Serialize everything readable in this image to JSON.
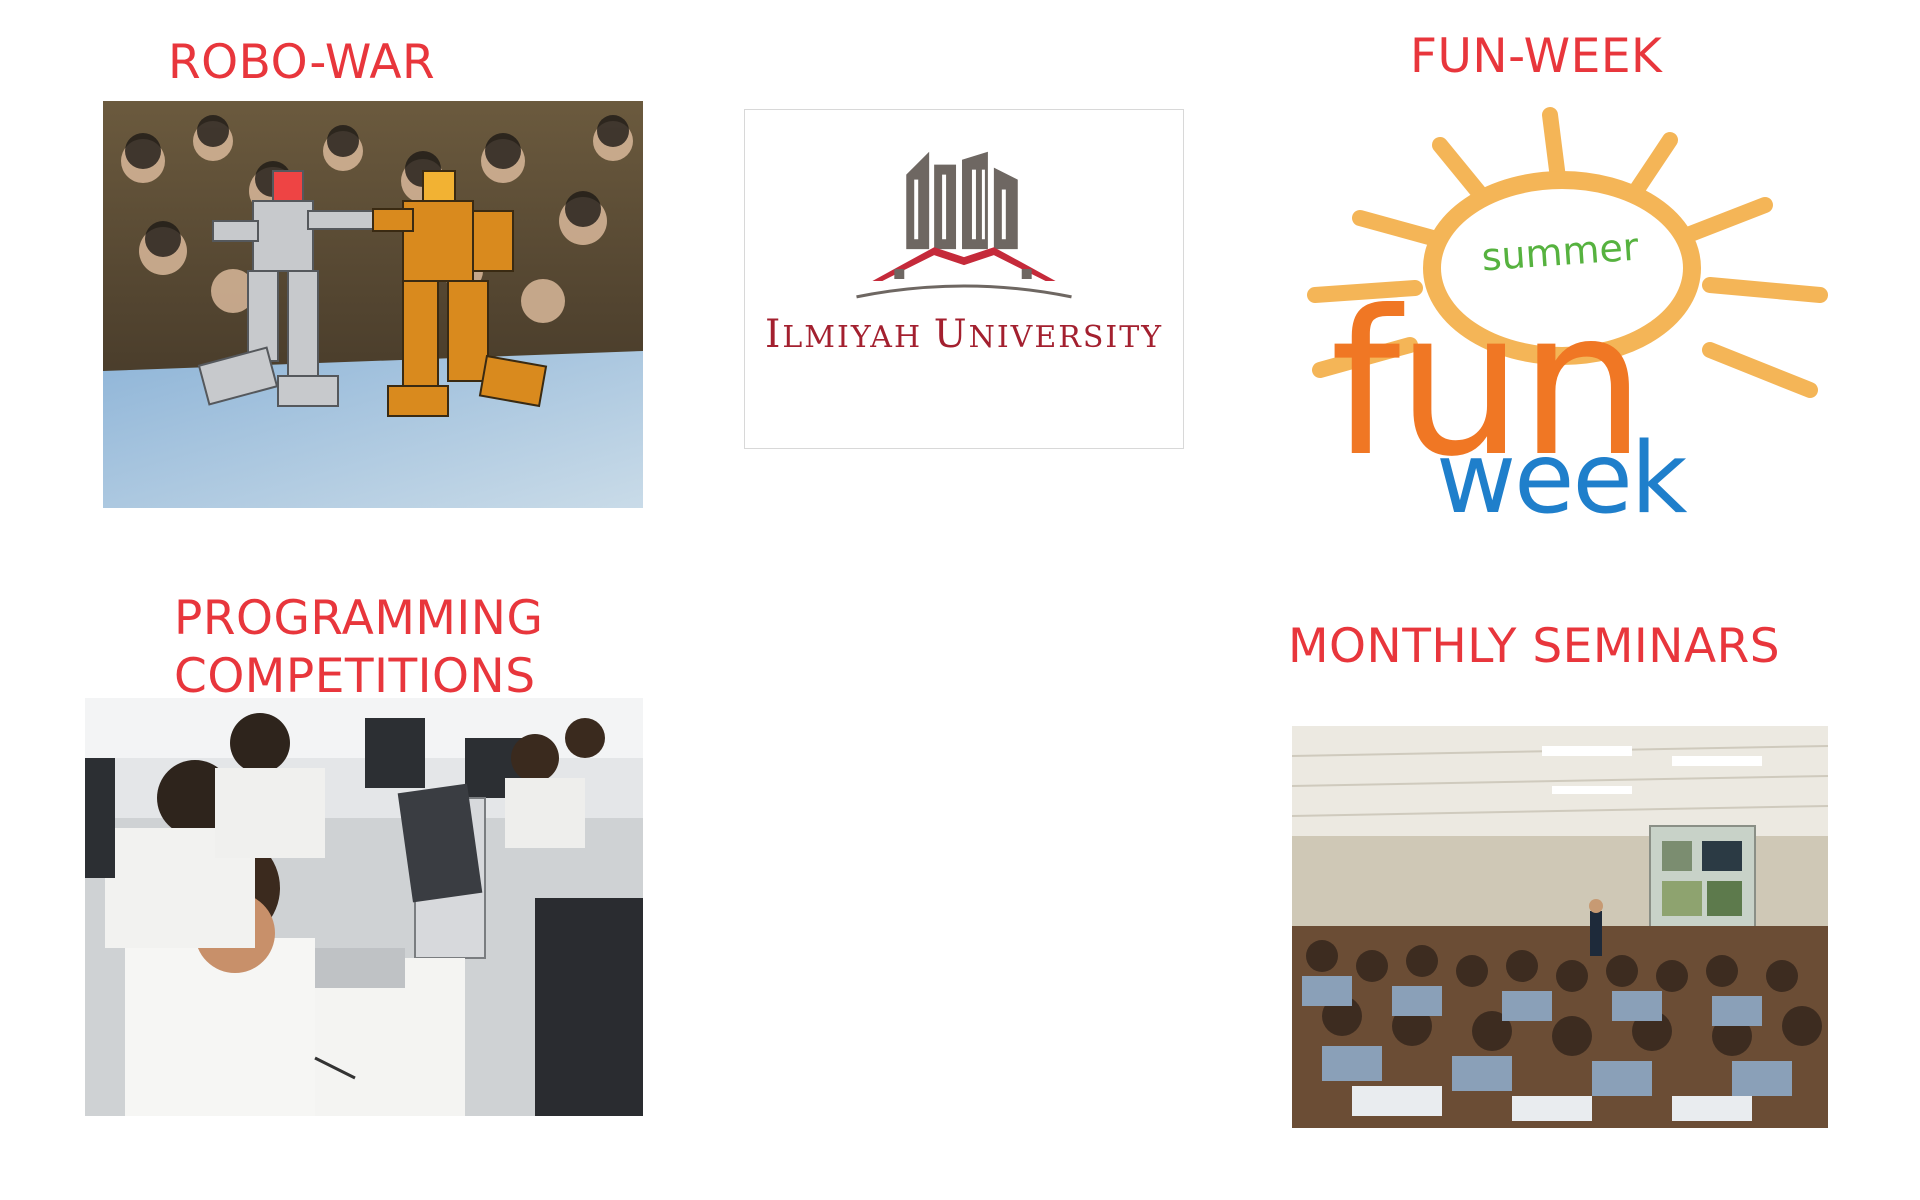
{
  "headings": {
    "robo_war": "ROBO-WAR",
    "fun_week": "FUN-WEEK",
    "programming": [
      "PROGRAMMING",
      "COMPETITIONS"
    ],
    "seminars": "MONTHLY SEMINARS"
  },
  "university_logo": {
    "name_first": "I",
    "name_rest_1": "LMIYAH ",
    "name_second": "U",
    "name_rest_2": "NIVERSITY"
  },
  "fun_week_logo": {
    "summer": "summer",
    "fun": "fun",
    "week": "week"
  },
  "colors": {
    "heading": "#e8363c",
    "university": "#a3202f",
    "sun": "#f4b557",
    "summer": "#56b23f",
    "fun": "#f07724",
    "week": "#1f7fcb"
  },
  "images": {
    "robo_war": "robot-fight-photo",
    "programming": "students-coding-photo",
    "seminars": "lecture-hall-photo"
  }
}
